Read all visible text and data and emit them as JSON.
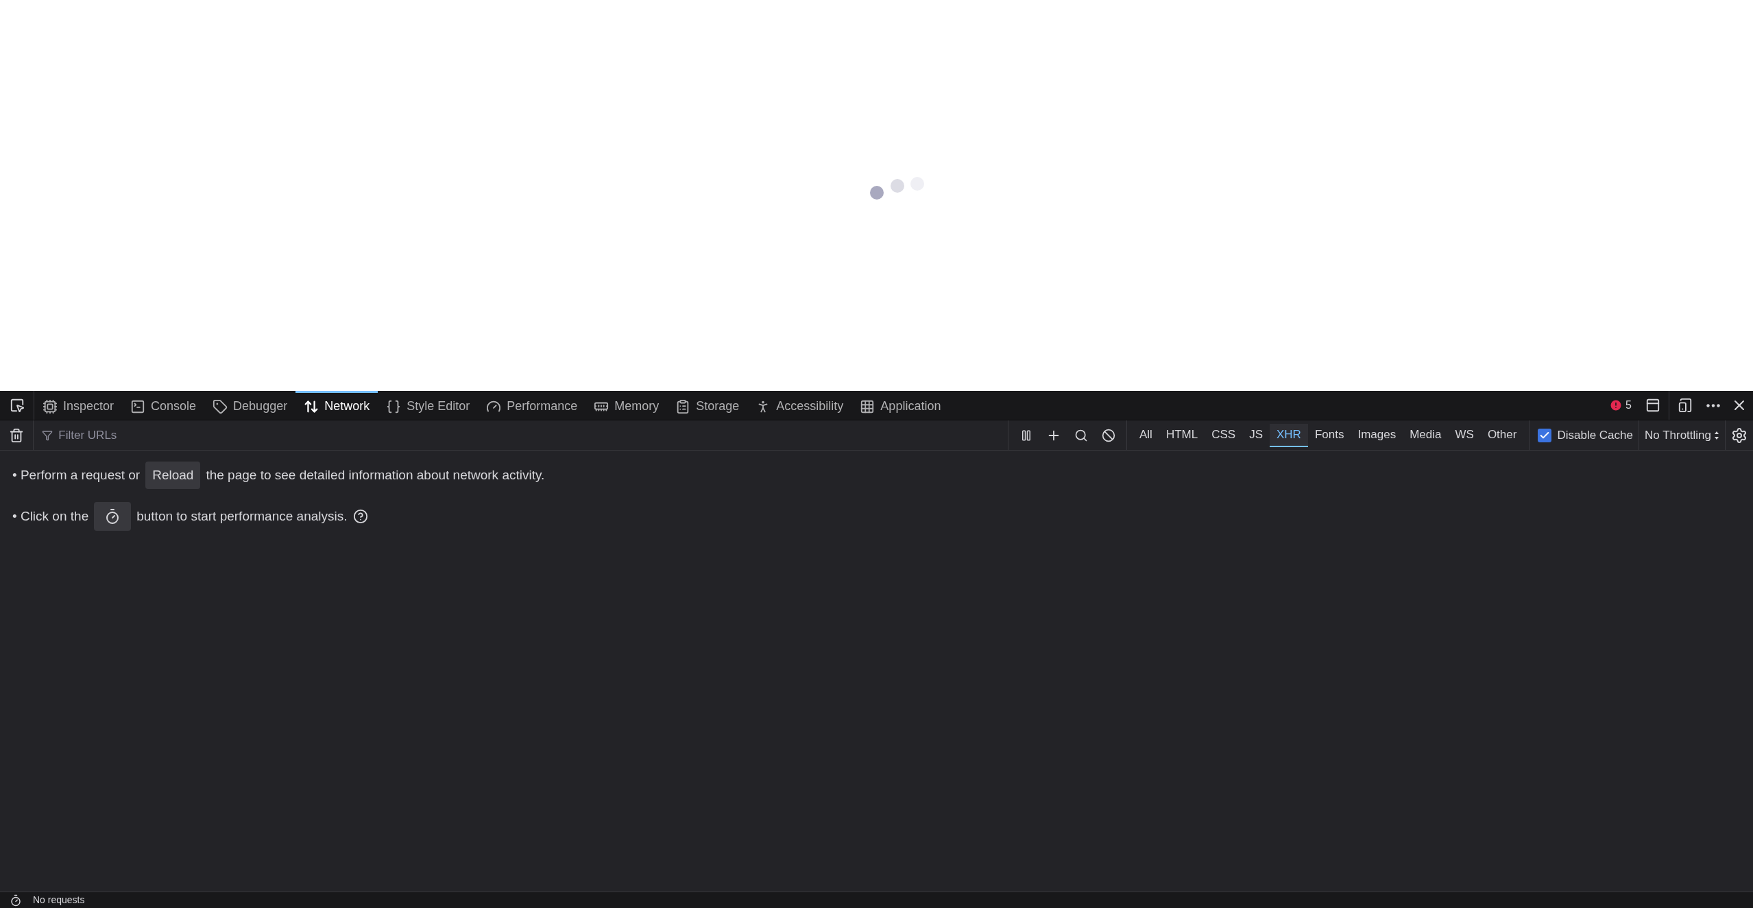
{
  "tabs": [
    {
      "label": "Inspector",
      "selected": false
    },
    {
      "label": "Console",
      "selected": false
    },
    {
      "label": "Debugger",
      "selected": false
    },
    {
      "label": "Network",
      "selected": true
    },
    {
      "label": "Style Editor",
      "selected": false
    },
    {
      "label": "Performance",
      "selected": false
    },
    {
      "label": "Memory",
      "selected": false
    },
    {
      "label": "Storage",
      "selected": false
    },
    {
      "label": "Accessibility",
      "selected": false
    },
    {
      "label": "Application",
      "selected": false
    }
  ],
  "error_count": "5",
  "toolbar": {
    "filter_placeholder": "Filter URLs",
    "filters": [
      {
        "label": "All",
        "selected": false
      },
      {
        "label": "HTML",
        "selected": false
      },
      {
        "label": "CSS",
        "selected": false
      },
      {
        "label": "JS",
        "selected": false
      },
      {
        "label": "XHR",
        "selected": true
      },
      {
        "label": "Fonts",
        "selected": false
      },
      {
        "label": "Images",
        "selected": false
      },
      {
        "label": "Media",
        "selected": false
      },
      {
        "label": "WS",
        "selected": false
      },
      {
        "label": "Other",
        "selected": false
      }
    ],
    "disable_cache": {
      "label": "Disable Cache",
      "checked": true
    },
    "throttling": "No Throttling"
  },
  "messages": {
    "reload_before": "• Perform a request or",
    "reload_button": "Reload",
    "reload_after": "the page to see detailed information about network activity.",
    "perf_before": "• Click on the",
    "perf_after": "button to start performance analysis."
  },
  "status_bar": {
    "text": "No requests"
  }
}
